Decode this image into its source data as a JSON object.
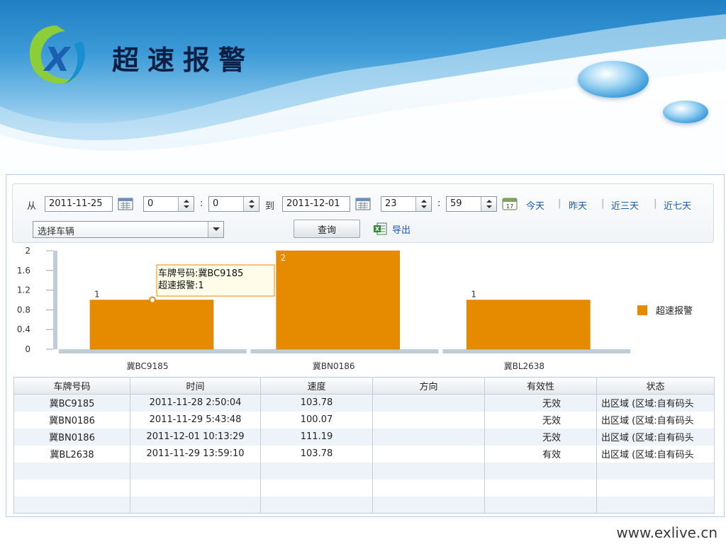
{
  "header": {
    "title": "超速报警"
  },
  "filter": {
    "from_label": "从",
    "to_label": "到",
    "time_sep": ":",
    "start_date": "2011-11-25",
    "start_hour": "0",
    "start_minute": "0",
    "end_date": "2011-12-01",
    "end_hour": "23",
    "end_minute": "59",
    "quick_links": [
      "今天",
      "昨天",
      "近三天",
      "近七天"
    ],
    "link_separator": "|",
    "vehicle_placeholder": "选择车辆",
    "query_label": "查询",
    "export_label": "导出"
  },
  "chart_data": {
    "type": "bar",
    "categories": [
      "冀BC9185",
      "冀BN0186",
      "冀BL2638"
    ],
    "series": [
      {
        "name": "超速报警",
        "values": [
          1,
          2,
          1
        ],
        "color": "#e68a00"
      }
    ],
    "ylim": [
      0,
      2
    ],
    "yticks": [
      "0",
      "0.4",
      "0.8",
      "1.2",
      "1.6",
      "2"
    ],
    "data_labels": [
      "1",
      "2",
      "1"
    ],
    "legend": "right",
    "tooltip": {
      "lines": [
        "车牌号码:冀BC9185",
        "超速报警:1"
      ]
    }
  },
  "table": {
    "columns": [
      "车牌号码",
      "时间",
      "速度",
      "方向",
      "有效性",
      "状态"
    ],
    "rows": [
      [
        "冀BC9185",
        "2011-11-28 2:50:04",
        "103.78",
        "",
        "无效",
        "出区域 (区域:自有码头"
      ],
      [
        "冀BN0186",
        "2011-11-29 5:43:48",
        "100.07",
        "",
        "无效",
        "出区域 (区域:自有码头"
      ],
      [
        "冀BN0186",
        "2011-12-01 10:13:29",
        "111.19",
        "",
        "无效",
        "出区域 (区域:自有码头"
      ],
      [
        "冀BL2638",
        "2011-11-29 13:59:10",
        "103.78",
        "",
        "有效",
        "出区域 (区域:自有码头"
      ],
      [
        "",
        "",
        "",
        "",
        "",
        ""
      ],
      [
        "",
        "",
        "",
        "",
        "",
        ""
      ],
      [
        "",
        "",
        "",
        "",
        "",
        ""
      ]
    ]
  },
  "footer": {
    "url": "www.exlive.cn"
  },
  "colors": {
    "accent": "#e68a00",
    "link": "#1a5aa8",
    "axis": "#c0ccd8"
  }
}
